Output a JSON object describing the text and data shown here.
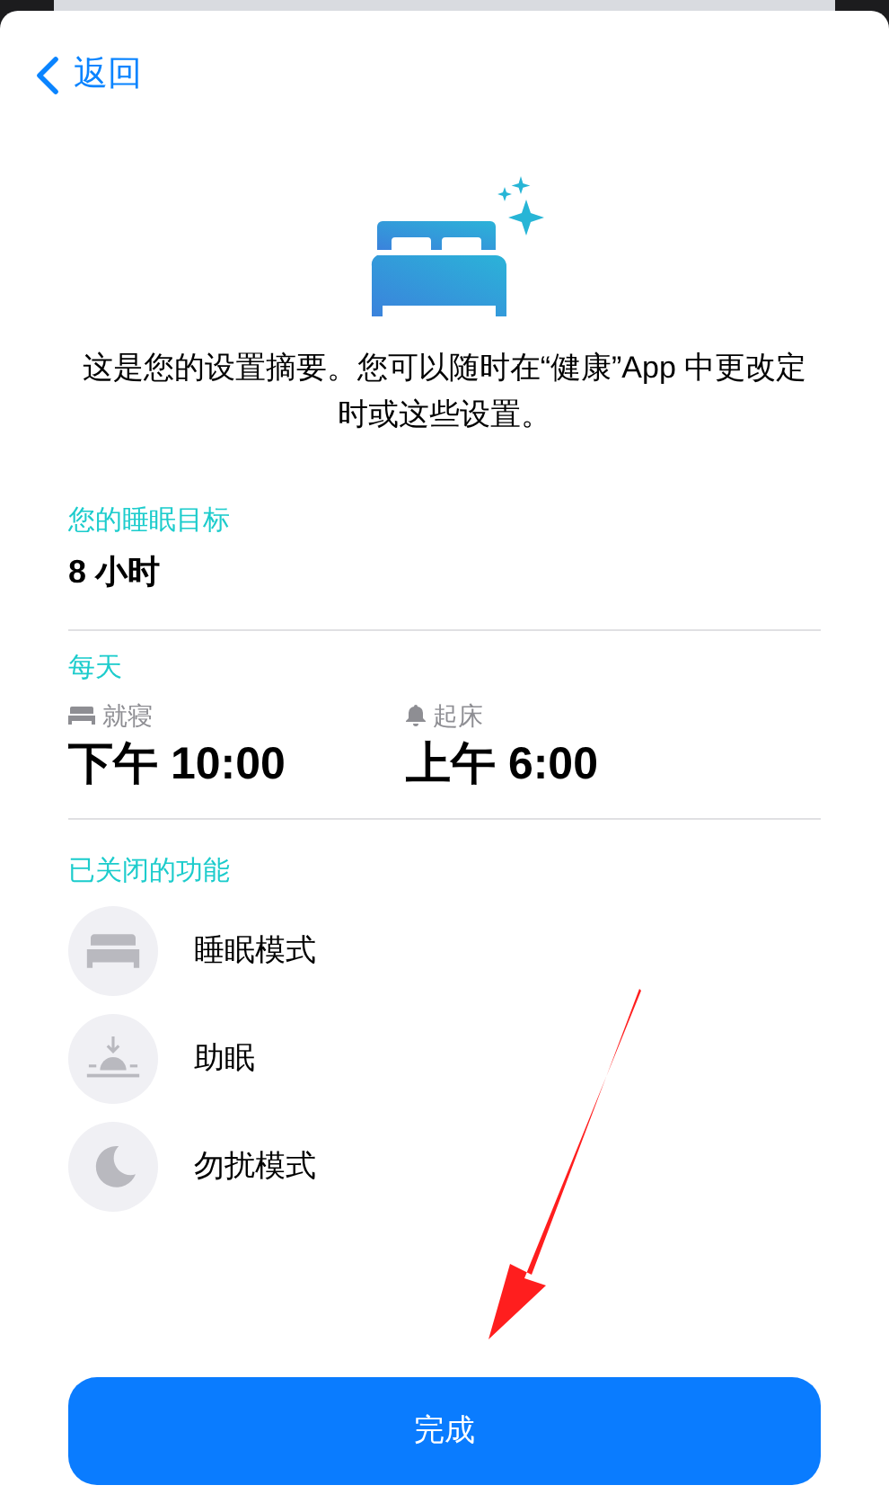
{
  "nav": {
    "back": "返回"
  },
  "summary": "这是您的设置摘要。您可以随时在“健康”App 中更改定时或这些设置。",
  "goal": {
    "heading": "您的睡眠目标",
    "value": "8 小时"
  },
  "schedule": {
    "heading": "每天",
    "times": [
      {
        "kind": "bed",
        "label": "就寝",
        "time": "下午 10:00"
      },
      {
        "kind": "alarm",
        "label": "起床",
        "time": "上午 6:00"
      }
    ]
  },
  "features": {
    "heading": "已关闭的功能",
    "items": [
      {
        "kind": "bed",
        "label": "睡眠模式"
      },
      {
        "kind": "sunset",
        "label": "助眠"
      },
      {
        "kind": "moon",
        "label": "勿扰模式"
      }
    ]
  },
  "done_button": "完成"
}
